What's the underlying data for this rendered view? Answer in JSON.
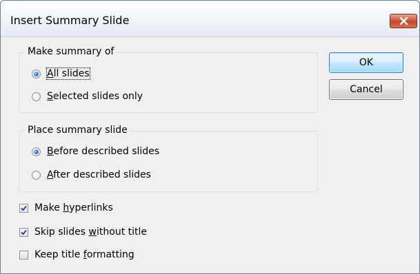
{
  "window": {
    "title": "Insert Summary Slide",
    "close_icon": "close-icon"
  },
  "make_summary": {
    "legend": "Make summary of",
    "options": [
      {
        "pre": "",
        "mnemonic": "A",
        "post": "ll slides",
        "checked": true
      },
      {
        "pre": "",
        "mnemonic": "S",
        "post": "elected slides only",
        "checked": false
      }
    ]
  },
  "place_summary": {
    "legend": "Place summary slide",
    "options": [
      {
        "pre": "",
        "mnemonic": "B",
        "post": "efore described slides",
        "checked": true
      },
      {
        "pre": "",
        "mnemonic": "A",
        "post": "fter described slides",
        "checked": false
      }
    ]
  },
  "checkboxes": [
    {
      "pre": "Make ",
      "mnemonic": "h",
      "post": "yperlinks",
      "checked": true
    },
    {
      "pre": "Skip slides ",
      "mnemonic": "w",
      "post": "ithout title",
      "checked": true
    },
    {
      "pre": "Keep title ",
      "mnemonic": "f",
      "post": "ormatting",
      "checked": false
    }
  ],
  "buttons": {
    "ok": "OK",
    "cancel": "Cancel"
  },
  "colors": {
    "accent": "#3c7fb1",
    "close_button": "#c7442a",
    "dialog_background": "#f0f0f0"
  }
}
